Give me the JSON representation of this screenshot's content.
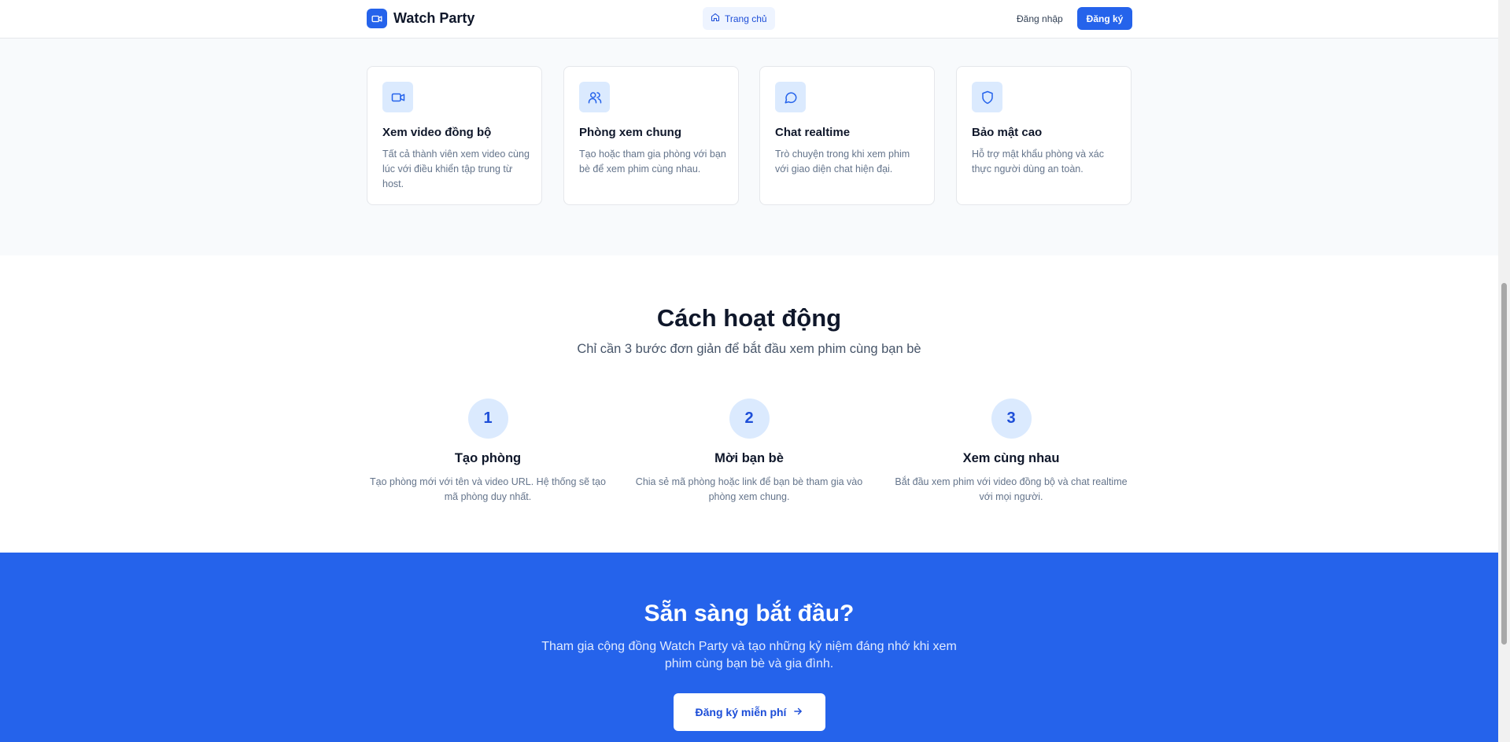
{
  "header": {
    "brand_name": "Watch Party",
    "nav_home": "Trang chủ",
    "login": "Đăng nhập",
    "register": "Đăng ký"
  },
  "features": [
    {
      "icon": "video-icon",
      "title": "Xem video đồng bộ",
      "desc": "Tất cả thành viên xem video cùng lúc với điều khiển tập trung từ host."
    },
    {
      "icon": "users-icon",
      "title": "Phòng xem chung",
      "desc": "Tạo hoặc tham gia phòng với bạn bè để xem phim cùng nhau."
    },
    {
      "icon": "chat-icon",
      "title": "Chat realtime",
      "desc": "Trò chuyện trong khi xem phim với giao diện chat hiện đại."
    },
    {
      "icon": "shield-icon",
      "title": "Bảo mật cao",
      "desc": "Hỗ trợ mật khẩu phòng và xác thực người dùng an toàn."
    }
  ],
  "how": {
    "title": "Cách hoạt động",
    "subtitle": "Chỉ cần 3 bước đơn giản để bắt đầu xem phim cùng bạn bè",
    "steps": [
      {
        "number": "1",
        "title": "Tạo phòng",
        "desc": "Tạo phòng mới với tên và video URL. Hệ thống sẽ tạo mã phòng duy nhất."
      },
      {
        "number": "2",
        "title": "Mời bạn bè",
        "desc": "Chia sẻ mã phòng hoặc link để bạn bè tham gia vào phòng xem chung."
      },
      {
        "number": "3",
        "title": "Xem cùng nhau",
        "desc": "Bắt đầu xem phim với video đồng bộ và chat realtime với mọi người."
      }
    ]
  },
  "cta": {
    "title": "Sẵn sàng bắt đầu?",
    "desc": "Tham gia cộng đồng Watch Party và tạo những kỷ niệm đáng nhớ khi xem phim cùng bạn bè và gia đình.",
    "button": "Đăng ký miễn phí"
  },
  "colors": {
    "primary": "#2563eb",
    "icon_bg": "#dbeafe",
    "section_bg": "#f8fafc"
  }
}
